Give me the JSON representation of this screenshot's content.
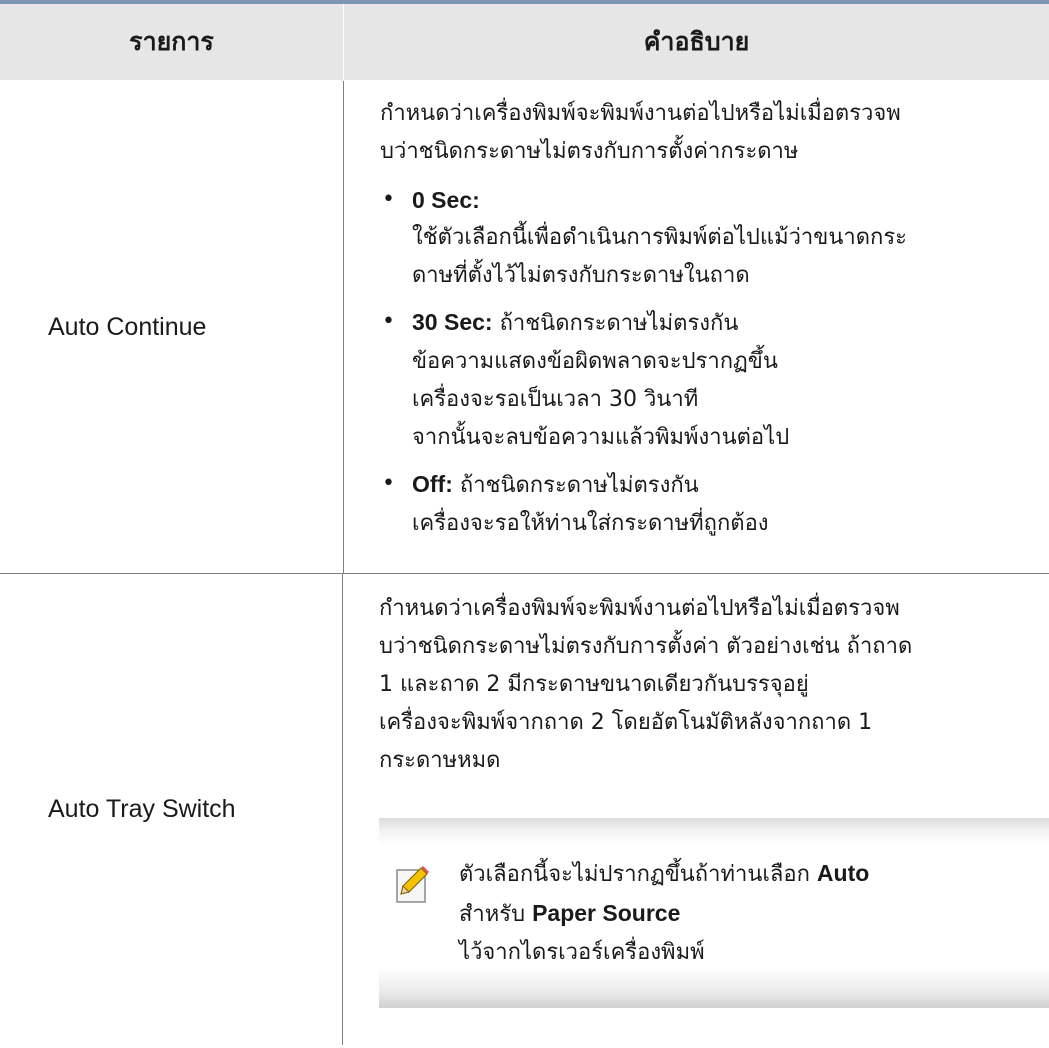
{
  "table": {
    "header": {
      "item": "รายการ",
      "description": "คำอธิบาย"
    },
    "rows": [
      {
        "name": "Auto Continue",
        "intro": "กำหนดว่าเครื่องพิมพ์จะพิมพ์งานต่อไปหรือไม่เมื่อตรวจพบว่าชนิดกระดาษไม่ตรงกับการตั้งค่ากระดาษ",
        "intro_lines": [
          "กำหนดว่าเครื่องพิมพ์จะพิมพ์งานต่อไปหรือไม่เมื่อตรวจพ",
          "บว่าชนิดกระดาษไม่ตรงกับการตั้งค่ากระดาษ"
        ],
        "options": [
          {
            "label": "0 Sec:",
            "lines": [
              "ใช้ตัวเลือกนี้เพื่อดำเนินการพิมพ์ต่อไปแม้ว่าขนาดกระ",
              "ดาษที่ตั้งไว้ไม่ตรงกับกระดาษในถาด"
            ]
          },
          {
            "label": "30 Sec:",
            "first": "ถ้าชนิดกระดาษไม่ตรงกัน",
            "lines": [
              "ข้อความแสดงข้อผิดพลาดจะปรากฏขึ้น",
              "เครื่องจะรอเป็นเวลา 30 วินาที",
              "จากนั้นจะลบข้อความแล้วพิมพ์งานต่อไป"
            ]
          },
          {
            "label": "Off:",
            "first": "ถ้าชนิดกระดาษไม่ตรงกัน",
            "lines": [
              "เครื่องจะรอให้ท่านใส่กระดาษที่ถูกต้อง"
            ]
          }
        ]
      },
      {
        "name": "Auto Tray Switch",
        "intro_lines": [
          "กำหนดว่าเครื่องพิมพ์จะพิมพ์งานต่อไปหรือไม่เมื่อตรวจพ",
          "บว่าชนิดกระดาษไม่ตรงกับการตั้งค่า ตัวอย่างเช่น ถ้าถาด",
          "1 และถาด 2 มีกระดาษขนาดเดียวกันบรรจุอยู่",
          "เครื่องจะพิมพ์จากถาด 2 โดยอัตโนมัติหลังจากถาด 1",
          "กระดาษหมด"
        ],
        "note": {
          "icon": "note-pencil-icon",
          "part1": "ตัวเลือกนี้จะไม่ปรากฏขึ้นถ้าท่านเลือก",
          "kw1": "Auto",
          "part2": "สำหรับ",
          "kw2": "Paper Source",
          "part3": "ไว้จากไดรเวอร์เครื่องพิมพ์"
        }
      }
    ]
  },
  "colors": {
    "top_rule": "#7d95b3",
    "header_bg": "#e6e6e6",
    "grid": "#808080"
  }
}
